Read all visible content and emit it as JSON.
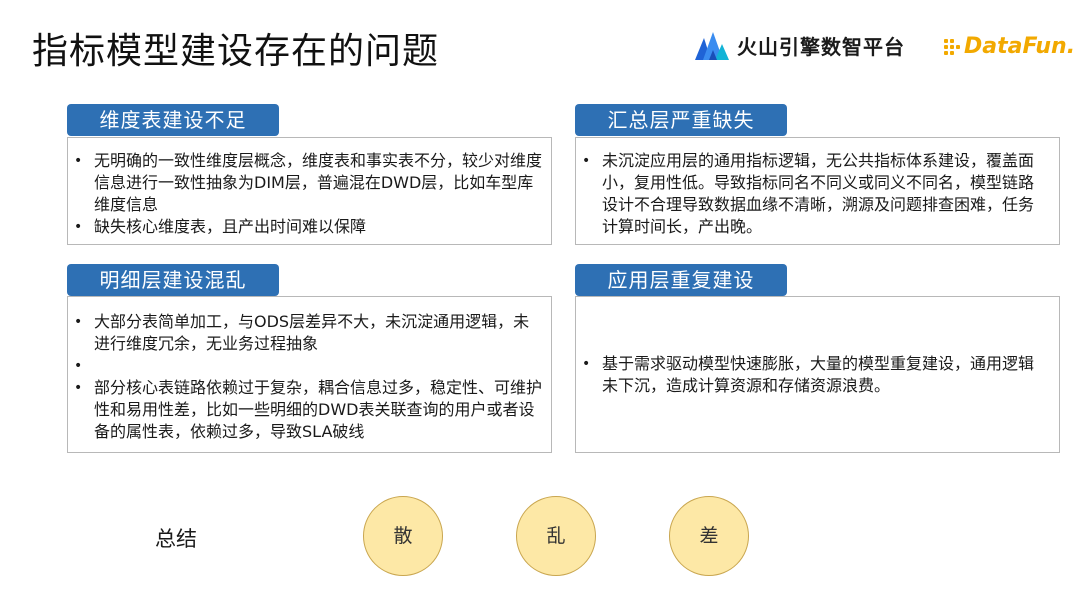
{
  "header": {
    "title": "指标模型建设存在的问题",
    "logo_volcano_text": "火山引擎数智平台",
    "logo_datafun_text": "DataFun."
  },
  "panels": {
    "dim": {
      "tag": "维度表建设不足",
      "items": [
        "无明确的一致性维度层概念，维度表和事实表不分，较少对维度信息进行一致性抽象为DIM层，普遍混在DWD层，比如车型库维度信息",
        "缺失核心维度表，且产出时间难以保障"
      ]
    },
    "summary_layer": {
      "tag": "汇总层严重缺失",
      "items": [
        "未沉淀应用层的通用指标逻辑，无公共指标体系建设，覆盖面小，复用性低。导致指标同名不同义或同义不同名，模型链路设计不合理导致数据血缘不清晰，溯源及问题排查困难，任务计算时间长，产出晚。"
      ]
    },
    "detail": {
      "tag": "明细层建设混乱",
      "items": [
        "大部分表简单加工，与ODS层差异不大，未沉淀通用逻辑，未进行维度冗余，无业务过程抽象",
        "",
        "部分核心表链路依赖过于复杂，耦合信息过多，稳定性、可维护性和易用性差，比如一些明细的DWD表关联查询的用户或者设备的属性表，依赖过多，导致SLA破线"
      ]
    },
    "app": {
      "tag": "应用层重复建设",
      "items": [
        "基于需求驱动模型快速膨胀，大量的模型重复建设，通用逻辑未下沉，造成计算资源和存储资源浪费。"
      ]
    }
  },
  "summary": {
    "label": "总结",
    "keywords": [
      "散",
      "乱",
      "差"
    ]
  },
  "colors": {
    "tag_bg": "#2e70b4",
    "circle_fill": "#fde8a6",
    "datafun_orange": "#f2a900",
    "volcano_blue": "#1f63d6"
  }
}
